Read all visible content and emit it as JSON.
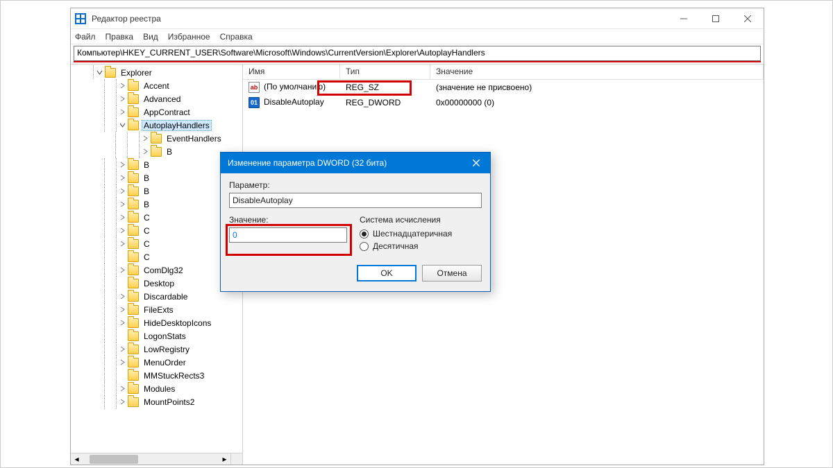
{
  "window": {
    "title": "Редактор реестра",
    "menu": [
      "Файл",
      "Правка",
      "Вид",
      "Избранное",
      "Справка"
    ],
    "address": "Компьютер\\HKEY_CURRENT_USER\\Software\\Microsoft\\Windows\\CurrentVersion\\Explorer\\AutoplayHandlers"
  },
  "tree": {
    "items": [
      {
        "indent": 1,
        "expander": "down",
        "label": "Explorer"
      },
      {
        "indent": 2,
        "expander": "right",
        "label": "Accent"
      },
      {
        "indent": 2,
        "expander": "right",
        "label": "Advanced"
      },
      {
        "indent": 2,
        "expander": "right",
        "label": "AppContract"
      },
      {
        "indent": 2,
        "expander": "down",
        "label": "AutoplayHandlers",
        "selected": true
      },
      {
        "indent": 3,
        "expander": "right",
        "label": "EventHandlers"
      },
      {
        "indent": 3,
        "expander": "right",
        "label": "B"
      },
      {
        "indent": 2,
        "expander": "right",
        "label": "B"
      },
      {
        "indent": 2,
        "expander": "right",
        "label": "B"
      },
      {
        "indent": 2,
        "expander": "right",
        "label": "B"
      },
      {
        "indent": 2,
        "expander": "right",
        "label": "B"
      },
      {
        "indent": 2,
        "expander": "right",
        "label": "C"
      },
      {
        "indent": 2,
        "expander": "right",
        "label": "C"
      },
      {
        "indent": 2,
        "expander": "right",
        "label": "C"
      },
      {
        "indent": 2,
        "expander": "none",
        "label": "C"
      },
      {
        "indent": 2,
        "expander": "right",
        "label": "ComDlg32"
      },
      {
        "indent": 2,
        "expander": "none",
        "label": "Desktop"
      },
      {
        "indent": 2,
        "expander": "right",
        "label": "Discardable"
      },
      {
        "indent": 2,
        "expander": "right",
        "label": "FileExts"
      },
      {
        "indent": 2,
        "expander": "right",
        "label": "HideDesktopIcons"
      },
      {
        "indent": 2,
        "expander": "none",
        "label": "LogonStats"
      },
      {
        "indent": 2,
        "expander": "right",
        "label": "LowRegistry"
      },
      {
        "indent": 2,
        "expander": "right",
        "label": "MenuOrder"
      },
      {
        "indent": 2,
        "expander": "none",
        "label": "MMStuckRects3"
      },
      {
        "indent": 2,
        "expander": "right",
        "label": "Modules"
      },
      {
        "indent": 2,
        "expander": "right",
        "label": "MountPoints2"
      }
    ]
  },
  "list": {
    "columns": {
      "name": "Имя",
      "type": "Тип",
      "value": "Значение"
    },
    "rows": [
      {
        "icon": "sz",
        "name": "(По умолчанию)",
        "type": "REG_SZ",
        "value": "(значение не присвоено)"
      },
      {
        "icon": "dw",
        "name": "DisableAutoplay",
        "type": "REG_DWORD",
        "value": "0x00000000 (0)"
      }
    ]
  },
  "dialog": {
    "title": "Изменение параметра DWORD (32 бита)",
    "param_label": "Параметр:",
    "param_value": "DisableAutoplay",
    "value_label": "Значение:",
    "value_value": "0",
    "radix_title": "Система исчисления",
    "radix_hex": "Шестнадцатеричная",
    "radix_dec": "Десятичная",
    "ok": "OK",
    "cancel": "Отмена"
  },
  "icons": {
    "sz_text": "ab",
    "dw_text": "011\n110"
  }
}
